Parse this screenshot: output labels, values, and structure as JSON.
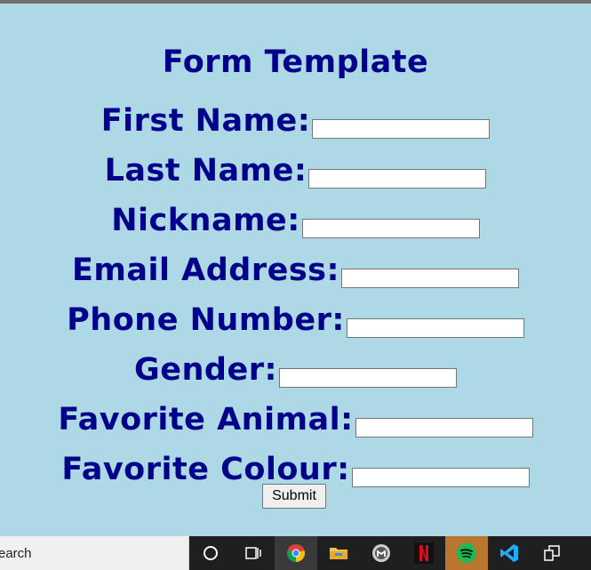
{
  "form": {
    "title": "Form Template",
    "fields": [
      {
        "label": "First Name:",
        "value": ""
      },
      {
        "label": "Last Name:",
        "value": ""
      },
      {
        "label": "Nickname:",
        "value": ""
      },
      {
        "label": "Email Address:",
        "value": ""
      },
      {
        "label": "Phone Number:",
        "value": ""
      },
      {
        "label": "Gender:",
        "value": ""
      },
      {
        "label": "Favorite Animal:",
        "value": ""
      },
      {
        "label": "Favorite Colour:",
        "value": ""
      }
    ],
    "submit_label": "Submit"
  },
  "taskbar": {
    "search_text": "earch",
    "icons": [
      "cortana-icon",
      "task-view-icon",
      "chrome-icon",
      "file-explorer-icon",
      "app-icon",
      "netflix-icon",
      "spotify-icon",
      "vscode-icon",
      "app-switch-icon"
    ]
  },
  "colors": {
    "background": "#add8e6",
    "label": "#00008b",
    "taskbar": "#1f1f1f"
  }
}
